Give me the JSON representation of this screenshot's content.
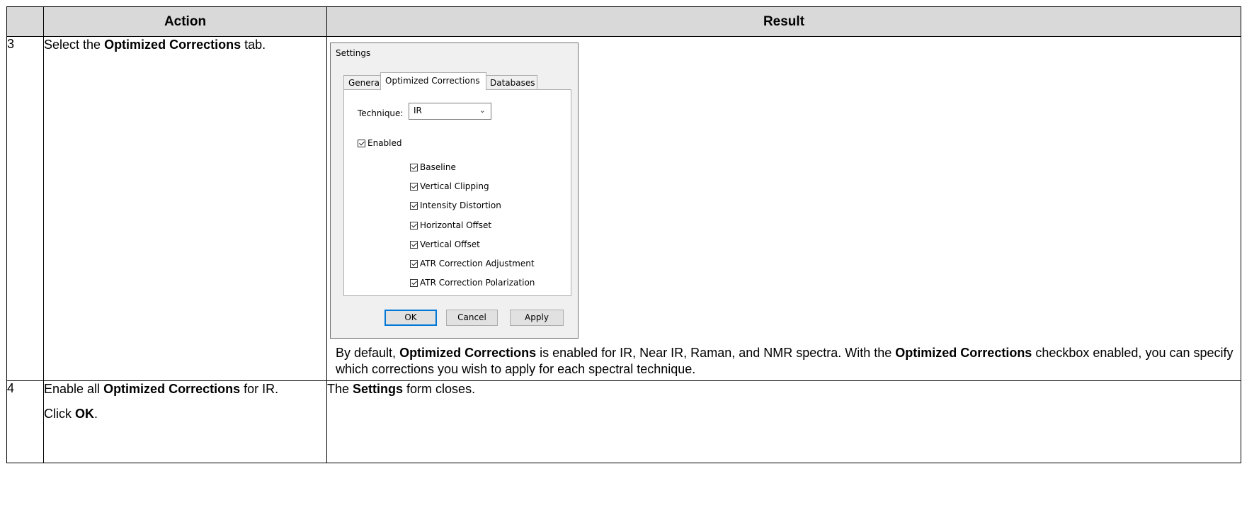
{
  "header": {
    "action": "Action",
    "result": "Result"
  },
  "rows": [
    {
      "number": "3",
      "action": {
        "pre": "Select the ",
        "bold": "Optimized Corrections",
        "post": " tab."
      },
      "dialog": {
        "title": "Settings",
        "tabs": [
          "General",
          "Optimized Corrections",
          "Databases"
        ],
        "technique_label": "Technique:",
        "technique_value": "IR",
        "enabled_label": "Enabled",
        "corrections": [
          "Baseline",
          "Vertical Clipping",
          "Intensity Distortion",
          "Horizontal Offset",
          "Vertical Offset",
          "ATR Correction Adjustment",
          "ATR Correction Polarization"
        ],
        "buttons": {
          "ok": "OK",
          "cancel": "Cancel",
          "apply": "Apply"
        }
      },
      "result_text": {
        "t1": "By default, ",
        "b1": "Optimized Corrections",
        "t2": " is enabled for IR, Near IR, Raman, and NMR spectra. With the ",
        "b2": "Optimized Corrections",
        "t3": " checkbox enabled, you can specify which corrections you wish to apply for each spectral technique."
      }
    },
    {
      "number": "4",
      "action": {
        "line1_pre": "Enable all ",
        "line1_bold": "Optimized Corrections",
        "line1_post": " for IR.",
        "line2_pre": "Click ",
        "line2_bold": "OK",
        "line2_post": "."
      },
      "result": {
        "pre": "The ",
        "bold": "Settings",
        "post": " form closes."
      }
    }
  ]
}
